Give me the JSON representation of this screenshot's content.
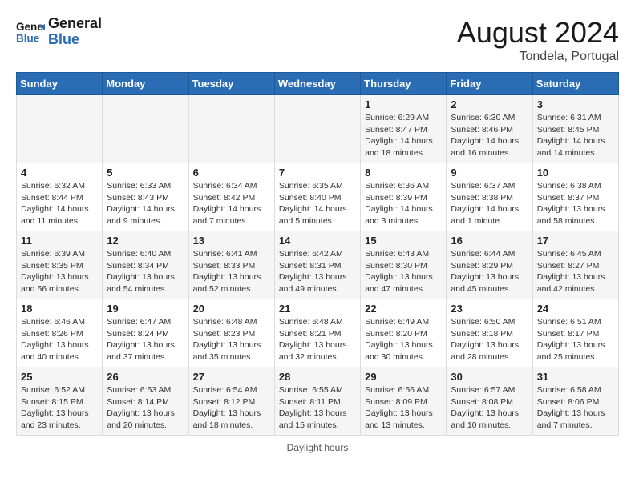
{
  "header": {
    "logo_general": "General",
    "logo_blue": "Blue",
    "month_title": "August 2024",
    "location": "Tondela, Portugal"
  },
  "days_of_week": [
    "Sunday",
    "Monday",
    "Tuesday",
    "Wednesday",
    "Thursday",
    "Friday",
    "Saturday"
  ],
  "footer": {
    "note": "Daylight hours"
  },
  "weeks": [
    [
      {
        "day": "",
        "sunrise": "",
        "sunset": "",
        "daylight": ""
      },
      {
        "day": "",
        "sunrise": "",
        "sunset": "",
        "daylight": ""
      },
      {
        "day": "",
        "sunrise": "",
        "sunset": "",
        "daylight": ""
      },
      {
        "day": "",
        "sunrise": "",
        "sunset": "",
        "daylight": ""
      },
      {
        "day": "1",
        "sunrise": "Sunrise: 6:29 AM",
        "sunset": "Sunset: 8:47 PM",
        "daylight": "Daylight: 14 hours and 18 minutes."
      },
      {
        "day": "2",
        "sunrise": "Sunrise: 6:30 AM",
        "sunset": "Sunset: 8:46 PM",
        "daylight": "Daylight: 14 hours and 16 minutes."
      },
      {
        "day": "3",
        "sunrise": "Sunrise: 6:31 AM",
        "sunset": "Sunset: 8:45 PM",
        "daylight": "Daylight: 14 hours and 14 minutes."
      }
    ],
    [
      {
        "day": "4",
        "sunrise": "Sunrise: 6:32 AM",
        "sunset": "Sunset: 8:44 PM",
        "daylight": "Daylight: 14 hours and 11 minutes."
      },
      {
        "day": "5",
        "sunrise": "Sunrise: 6:33 AM",
        "sunset": "Sunset: 8:43 PM",
        "daylight": "Daylight: 14 hours and 9 minutes."
      },
      {
        "day": "6",
        "sunrise": "Sunrise: 6:34 AM",
        "sunset": "Sunset: 8:42 PM",
        "daylight": "Daylight: 14 hours and 7 minutes."
      },
      {
        "day": "7",
        "sunrise": "Sunrise: 6:35 AM",
        "sunset": "Sunset: 8:40 PM",
        "daylight": "Daylight: 14 hours and 5 minutes."
      },
      {
        "day": "8",
        "sunrise": "Sunrise: 6:36 AM",
        "sunset": "Sunset: 8:39 PM",
        "daylight": "Daylight: 14 hours and 3 minutes."
      },
      {
        "day": "9",
        "sunrise": "Sunrise: 6:37 AM",
        "sunset": "Sunset: 8:38 PM",
        "daylight": "Daylight: 14 hours and 1 minute."
      },
      {
        "day": "10",
        "sunrise": "Sunrise: 6:38 AM",
        "sunset": "Sunset: 8:37 PM",
        "daylight": "Daylight: 13 hours and 58 minutes."
      }
    ],
    [
      {
        "day": "11",
        "sunrise": "Sunrise: 6:39 AM",
        "sunset": "Sunset: 8:35 PM",
        "daylight": "Daylight: 13 hours and 56 minutes."
      },
      {
        "day": "12",
        "sunrise": "Sunrise: 6:40 AM",
        "sunset": "Sunset: 8:34 PM",
        "daylight": "Daylight: 13 hours and 54 minutes."
      },
      {
        "day": "13",
        "sunrise": "Sunrise: 6:41 AM",
        "sunset": "Sunset: 8:33 PM",
        "daylight": "Daylight: 13 hours and 52 minutes."
      },
      {
        "day": "14",
        "sunrise": "Sunrise: 6:42 AM",
        "sunset": "Sunset: 8:31 PM",
        "daylight": "Daylight: 13 hours and 49 minutes."
      },
      {
        "day": "15",
        "sunrise": "Sunrise: 6:43 AM",
        "sunset": "Sunset: 8:30 PM",
        "daylight": "Daylight: 13 hours and 47 minutes."
      },
      {
        "day": "16",
        "sunrise": "Sunrise: 6:44 AM",
        "sunset": "Sunset: 8:29 PM",
        "daylight": "Daylight: 13 hours and 45 minutes."
      },
      {
        "day": "17",
        "sunrise": "Sunrise: 6:45 AM",
        "sunset": "Sunset: 8:27 PM",
        "daylight": "Daylight: 13 hours and 42 minutes."
      }
    ],
    [
      {
        "day": "18",
        "sunrise": "Sunrise: 6:46 AM",
        "sunset": "Sunset: 8:26 PM",
        "daylight": "Daylight: 13 hours and 40 minutes."
      },
      {
        "day": "19",
        "sunrise": "Sunrise: 6:47 AM",
        "sunset": "Sunset: 8:24 PM",
        "daylight": "Daylight: 13 hours and 37 minutes."
      },
      {
        "day": "20",
        "sunrise": "Sunrise: 6:48 AM",
        "sunset": "Sunset: 8:23 PM",
        "daylight": "Daylight: 13 hours and 35 minutes."
      },
      {
        "day": "21",
        "sunrise": "Sunrise: 6:48 AM",
        "sunset": "Sunset: 8:21 PM",
        "daylight": "Daylight: 13 hours and 32 minutes."
      },
      {
        "day": "22",
        "sunrise": "Sunrise: 6:49 AM",
        "sunset": "Sunset: 8:20 PM",
        "daylight": "Daylight: 13 hours and 30 minutes."
      },
      {
        "day": "23",
        "sunrise": "Sunrise: 6:50 AM",
        "sunset": "Sunset: 8:18 PM",
        "daylight": "Daylight: 13 hours and 28 minutes."
      },
      {
        "day": "24",
        "sunrise": "Sunrise: 6:51 AM",
        "sunset": "Sunset: 8:17 PM",
        "daylight": "Daylight: 13 hours and 25 minutes."
      }
    ],
    [
      {
        "day": "25",
        "sunrise": "Sunrise: 6:52 AM",
        "sunset": "Sunset: 8:15 PM",
        "daylight": "Daylight: 13 hours and 23 minutes."
      },
      {
        "day": "26",
        "sunrise": "Sunrise: 6:53 AM",
        "sunset": "Sunset: 8:14 PM",
        "daylight": "Daylight: 13 hours and 20 minutes."
      },
      {
        "day": "27",
        "sunrise": "Sunrise: 6:54 AM",
        "sunset": "Sunset: 8:12 PM",
        "daylight": "Daylight: 13 hours and 18 minutes."
      },
      {
        "day": "28",
        "sunrise": "Sunrise: 6:55 AM",
        "sunset": "Sunset: 8:11 PM",
        "daylight": "Daylight: 13 hours and 15 minutes."
      },
      {
        "day": "29",
        "sunrise": "Sunrise: 6:56 AM",
        "sunset": "Sunset: 8:09 PM",
        "daylight": "Daylight: 13 hours and 13 minutes."
      },
      {
        "day": "30",
        "sunrise": "Sunrise: 6:57 AM",
        "sunset": "Sunset: 8:08 PM",
        "daylight": "Daylight: 13 hours and 10 minutes."
      },
      {
        "day": "31",
        "sunrise": "Sunrise: 6:58 AM",
        "sunset": "Sunset: 8:06 PM",
        "daylight": "Daylight: 13 hours and 7 minutes."
      }
    ]
  ]
}
